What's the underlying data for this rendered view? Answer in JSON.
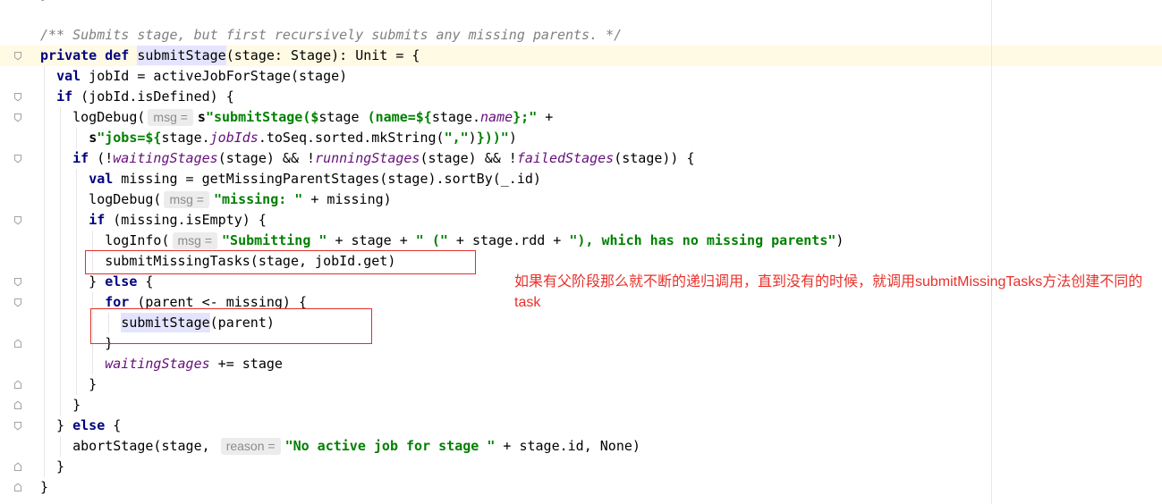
{
  "colors": {
    "keyword": "#000080",
    "string": "#008000",
    "comment": "#808080",
    "field": "#660e7a",
    "hint_text": "#8c8c8c",
    "hint_background": "#ececec",
    "occurrence_highlight": "#e4e4ff",
    "current_line": "#fffae3",
    "annotation": "#e8302a",
    "right_margin": "#e8e8e8"
  },
  "editor": {
    "lines": [
      {
        "tokens": [
          {
            "text": "}",
            "role": "plain"
          }
        ]
      },
      {
        "tokens": []
      },
      {
        "tokens": [
          {
            "text": "/** Submits stage, but first recursively submits any missing parents. */",
            "role": "comment"
          }
        ]
      },
      {
        "current": true,
        "fold": "fold-start-icon",
        "tokens": [
          {
            "text": "private",
            "role": "keyword"
          },
          {
            "text": " ",
            "role": "plain"
          },
          {
            "text": "def",
            "role": "keyword"
          },
          {
            "text": " ",
            "role": "plain"
          },
          {
            "text": "submitStage",
            "role": "occurrence",
            "caret": true
          },
          {
            "text": "(stage: Stage): Unit = {",
            "role": "plain"
          }
        ]
      },
      {
        "tokens": [
          {
            "text": "  ",
            "role": "plain"
          },
          {
            "text": "val",
            "role": "keyword"
          },
          {
            "text": " jobId = activeJobForStage(stage)",
            "role": "plain"
          }
        ]
      },
      {
        "fold": "fold-start-icon",
        "tokens": [
          {
            "text": "  ",
            "role": "plain"
          },
          {
            "text": "if",
            "role": "keyword"
          },
          {
            "text": " (jobId.isDefined) {",
            "role": "plain"
          }
        ]
      },
      {
        "fold": "fold-start-icon",
        "tokens": [
          {
            "text": "    logDebug(",
            "role": "plain"
          },
          {
            "text": "msg =",
            "role": "hint"
          },
          {
            "text": "s",
            "role": "interpolator"
          },
          {
            "text": "\"submitStage($",
            "role": "string"
          },
          {
            "text": "stage",
            "role": "plain"
          },
          {
            "text": " (name=${",
            "role": "string"
          },
          {
            "text": "stage.",
            "role": "plain"
          },
          {
            "text": "name",
            "role": "field"
          },
          {
            "text": "};\"",
            "role": "string"
          },
          {
            "text": " +",
            "role": "plain"
          }
        ]
      },
      {
        "tokens": [
          {
            "text": "      ",
            "role": "plain"
          },
          {
            "text": "s",
            "role": "interpolator"
          },
          {
            "text": "\"jobs=${",
            "role": "string"
          },
          {
            "text": "stage.",
            "role": "plain"
          },
          {
            "text": "jobIds",
            "role": "field"
          },
          {
            "text": ".toSeq.sorted.mkString(",
            "role": "plain"
          },
          {
            "text": "\",\"",
            "role": "string"
          },
          {
            "text": ")",
            "role": "plain"
          },
          {
            "text": "}))\"",
            "role": "string"
          },
          {
            "text": ")",
            "role": "plain"
          }
        ]
      },
      {
        "fold": "fold-start-icon",
        "tokens": [
          {
            "text": "    ",
            "role": "plain"
          },
          {
            "text": "if",
            "role": "keyword"
          },
          {
            "text": " (!",
            "role": "plain"
          },
          {
            "text": "waitingStages",
            "role": "field"
          },
          {
            "text": "(stage) && !",
            "role": "plain"
          },
          {
            "text": "runningStages",
            "role": "field"
          },
          {
            "text": "(stage) && !",
            "role": "plain"
          },
          {
            "text": "failedStages",
            "role": "field"
          },
          {
            "text": "(stage)) {",
            "role": "plain"
          }
        ]
      },
      {
        "tokens": [
          {
            "text": "      ",
            "role": "plain"
          },
          {
            "text": "val",
            "role": "keyword"
          },
          {
            "text": " missing = getMissingParentStages(stage).sortBy(_.id)",
            "role": "plain"
          }
        ]
      },
      {
        "tokens": [
          {
            "text": "      logDebug(",
            "role": "plain"
          },
          {
            "text": "msg =",
            "role": "hint"
          },
          {
            "text": "\"missing: \"",
            "role": "string"
          },
          {
            "text": " + missing)",
            "role": "plain"
          }
        ]
      },
      {
        "fold": "fold-start-icon",
        "tokens": [
          {
            "text": "      ",
            "role": "plain"
          },
          {
            "text": "if",
            "role": "keyword"
          },
          {
            "text": " (missing.isEmpty) {",
            "role": "plain"
          }
        ]
      },
      {
        "tokens": [
          {
            "text": "        logInfo(",
            "role": "plain"
          },
          {
            "text": "msg =",
            "role": "hint"
          },
          {
            "text": "\"Submitting \"",
            "role": "string"
          },
          {
            "text": " + stage + ",
            "role": "plain"
          },
          {
            "text": "\" (\"",
            "role": "string"
          },
          {
            "text": " + stage.rdd + ",
            "role": "plain"
          },
          {
            "text": "\"), which has no missing parents\"",
            "role": "string"
          },
          {
            "text": ")",
            "role": "plain"
          }
        ]
      },
      {
        "tokens": [
          {
            "text": "        submitMissingTasks(stage, jobId.get)",
            "role": "plain"
          }
        ]
      },
      {
        "fold": "fold-start-icon",
        "tokens": [
          {
            "text": "      } ",
            "role": "plain"
          },
          {
            "text": "else",
            "role": "keyword"
          },
          {
            "text": " {",
            "role": "plain"
          }
        ]
      },
      {
        "fold": "fold-start-icon",
        "tokens": [
          {
            "text": "        ",
            "role": "plain"
          },
          {
            "text": "for",
            "role": "keyword"
          },
          {
            "text": " (parent <- missing) {",
            "role": "plain"
          }
        ]
      },
      {
        "tokens": [
          {
            "text": "          ",
            "role": "plain"
          },
          {
            "text": "submitStage",
            "role": "occurrence"
          },
          {
            "text": "(parent)",
            "role": "plain"
          }
        ]
      },
      {
        "fold": "fold-end-icon",
        "tokens": [
          {
            "text": "        }",
            "role": "plain"
          }
        ]
      },
      {
        "tokens": [
          {
            "text": "        ",
            "role": "plain"
          },
          {
            "text": "waitingStages",
            "role": "field"
          },
          {
            "text": " += stage",
            "role": "plain"
          }
        ]
      },
      {
        "fold": "fold-end-icon",
        "tokens": [
          {
            "text": "      }",
            "role": "plain"
          }
        ]
      },
      {
        "fold": "fold-end-icon",
        "tokens": [
          {
            "text": "    }",
            "role": "plain"
          }
        ]
      },
      {
        "fold": "fold-start-icon",
        "tokens": [
          {
            "text": "  } ",
            "role": "plain"
          },
          {
            "text": "else",
            "role": "keyword"
          },
          {
            "text": " {",
            "role": "plain"
          }
        ]
      },
      {
        "tokens": [
          {
            "text": "    abortStage(stage, ",
            "role": "plain"
          },
          {
            "text": "reason =",
            "role": "hint"
          },
          {
            "text": "\"No active job for stage \"",
            "role": "string"
          },
          {
            "text": " + stage.id, None)",
            "role": "plain"
          }
        ]
      },
      {
        "fold": "fold-end-icon",
        "tokens": [
          {
            "text": "  }",
            "role": "plain"
          }
        ]
      },
      {
        "fold": "fold-end-icon",
        "tokens": [
          {
            "text": "}",
            "role": "plain"
          }
        ]
      }
    ]
  },
  "annotation": {
    "lines": [
      "如果有父阶段那么就不断的递归调用，直到没有的时候，就调用submitMissingTasks方法创建不同的",
      "task"
    ]
  }
}
